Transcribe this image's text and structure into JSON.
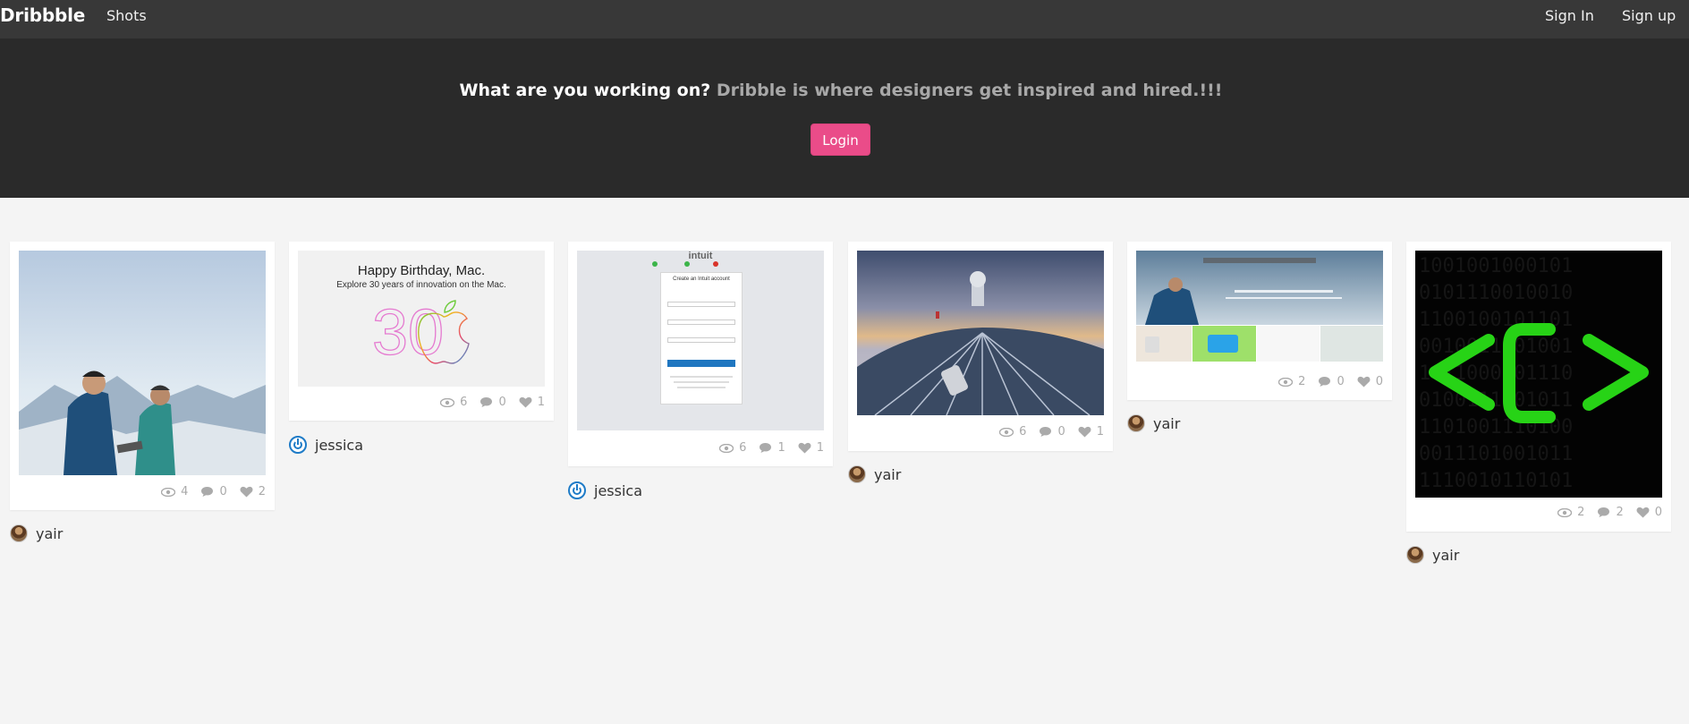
{
  "nav": {
    "brand": "Dribbble",
    "shots_label": "Shots",
    "sign_in_label": "Sign In",
    "sign_up_label": "Sign up"
  },
  "hero": {
    "tagline_lead": "What are you working on?",
    "tagline_rest": "Dribble is where designers get inspired and hired.!!!",
    "login_label": "Login",
    "login_color": "#ea4c89"
  },
  "shots": [
    {
      "image": "mountain-hikers",
      "views": "4",
      "comments": "0",
      "likes": "2",
      "author": "yair",
      "avatar": "yair-photo"
    },
    {
      "image": "happy-birthday-mac",
      "title": "Happy Birthday, Mac.",
      "subtitle": "Explore 30 years of innovation on the Mac.",
      "big_number": "30",
      "views": "6",
      "comments": "0",
      "likes": "1",
      "author": "jessica",
      "avatar": "power-icon"
    },
    {
      "image": "intuit-signup",
      "logo": "intuit",
      "form_title": "Create an Intuit account",
      "views": "6",
      "comments": "1",
      "likes": "1",
      "author": "jessica",
      "avatar": "power-icon"
    },
    {
      "image": "observatory-telescope",
      "views": "6",
      "comments": "0",
      "likes": "1",
      "author": "yair",
      "avatar": "yair-photo"
    },
    {
      "image": "apple-website",
      "views": "2",
      "comments": "0",
      "likes": "0",
      "author": "yair",
      "avatar": "yair-photo"
    },
    {
      "image": "code-brackets",
      "views": "2",
      "comments": "2",
      "likes": "0",
      "author": "yair",
      "avatar": "yair-photo"
    }
  ]
}
